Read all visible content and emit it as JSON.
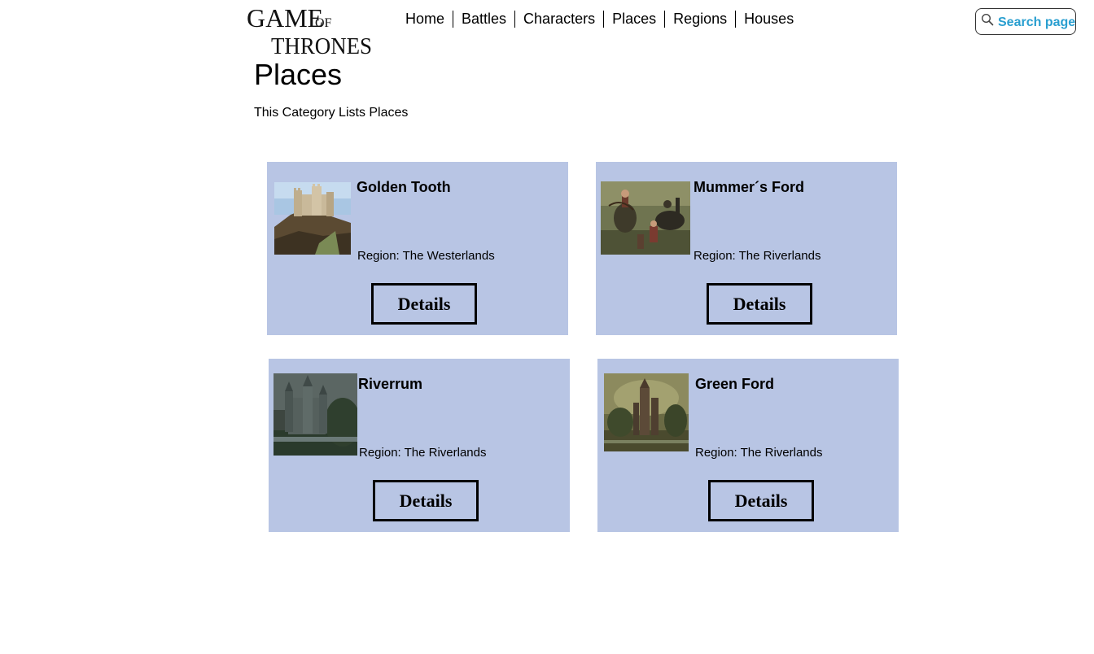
{
  "logo": {
    "line1_big": "GAME",
    "line1_small": "OF",
    "line2": "THRONES"
  },
  "nav": {
    "items": [
      "Home",
      "Battles",
      "Characters",
      "Places",
      "Regions",
      "Houses"
    ]
  },
  "search": {
    "label": "Search page",
    "icon": "magnifier-icon"
  },
  "header": {
    "title": "Places",
    "subtitle": "This Category Lists Places"
  },
  "places": [
    {
      "name": "Golden Tooth",
      "region": "Region: The Westerlands",
      "button": "Details",
      "image": "castle-on-hill"
    },
    {
      "name": "Mummer´s Ford",
      "region": "Region: The Riverlands",
      "button": "Details",
      "image": "riders-battle"
    },
    {
      "name": "Riverrum",
      "region": "Region: The Riverlands",
      "button": "Details",
      "image": "dark-castle"
    },
    {
      "name": "Green Ford",
      "region": "Region: The Riverlands",
      "button": "Details",
      "image": "ruined-tower"
    }
  ],
  "colors": {
    "card_background": "#b8c5e4",
    "search_text": "#2a9fd0"
  }
}
